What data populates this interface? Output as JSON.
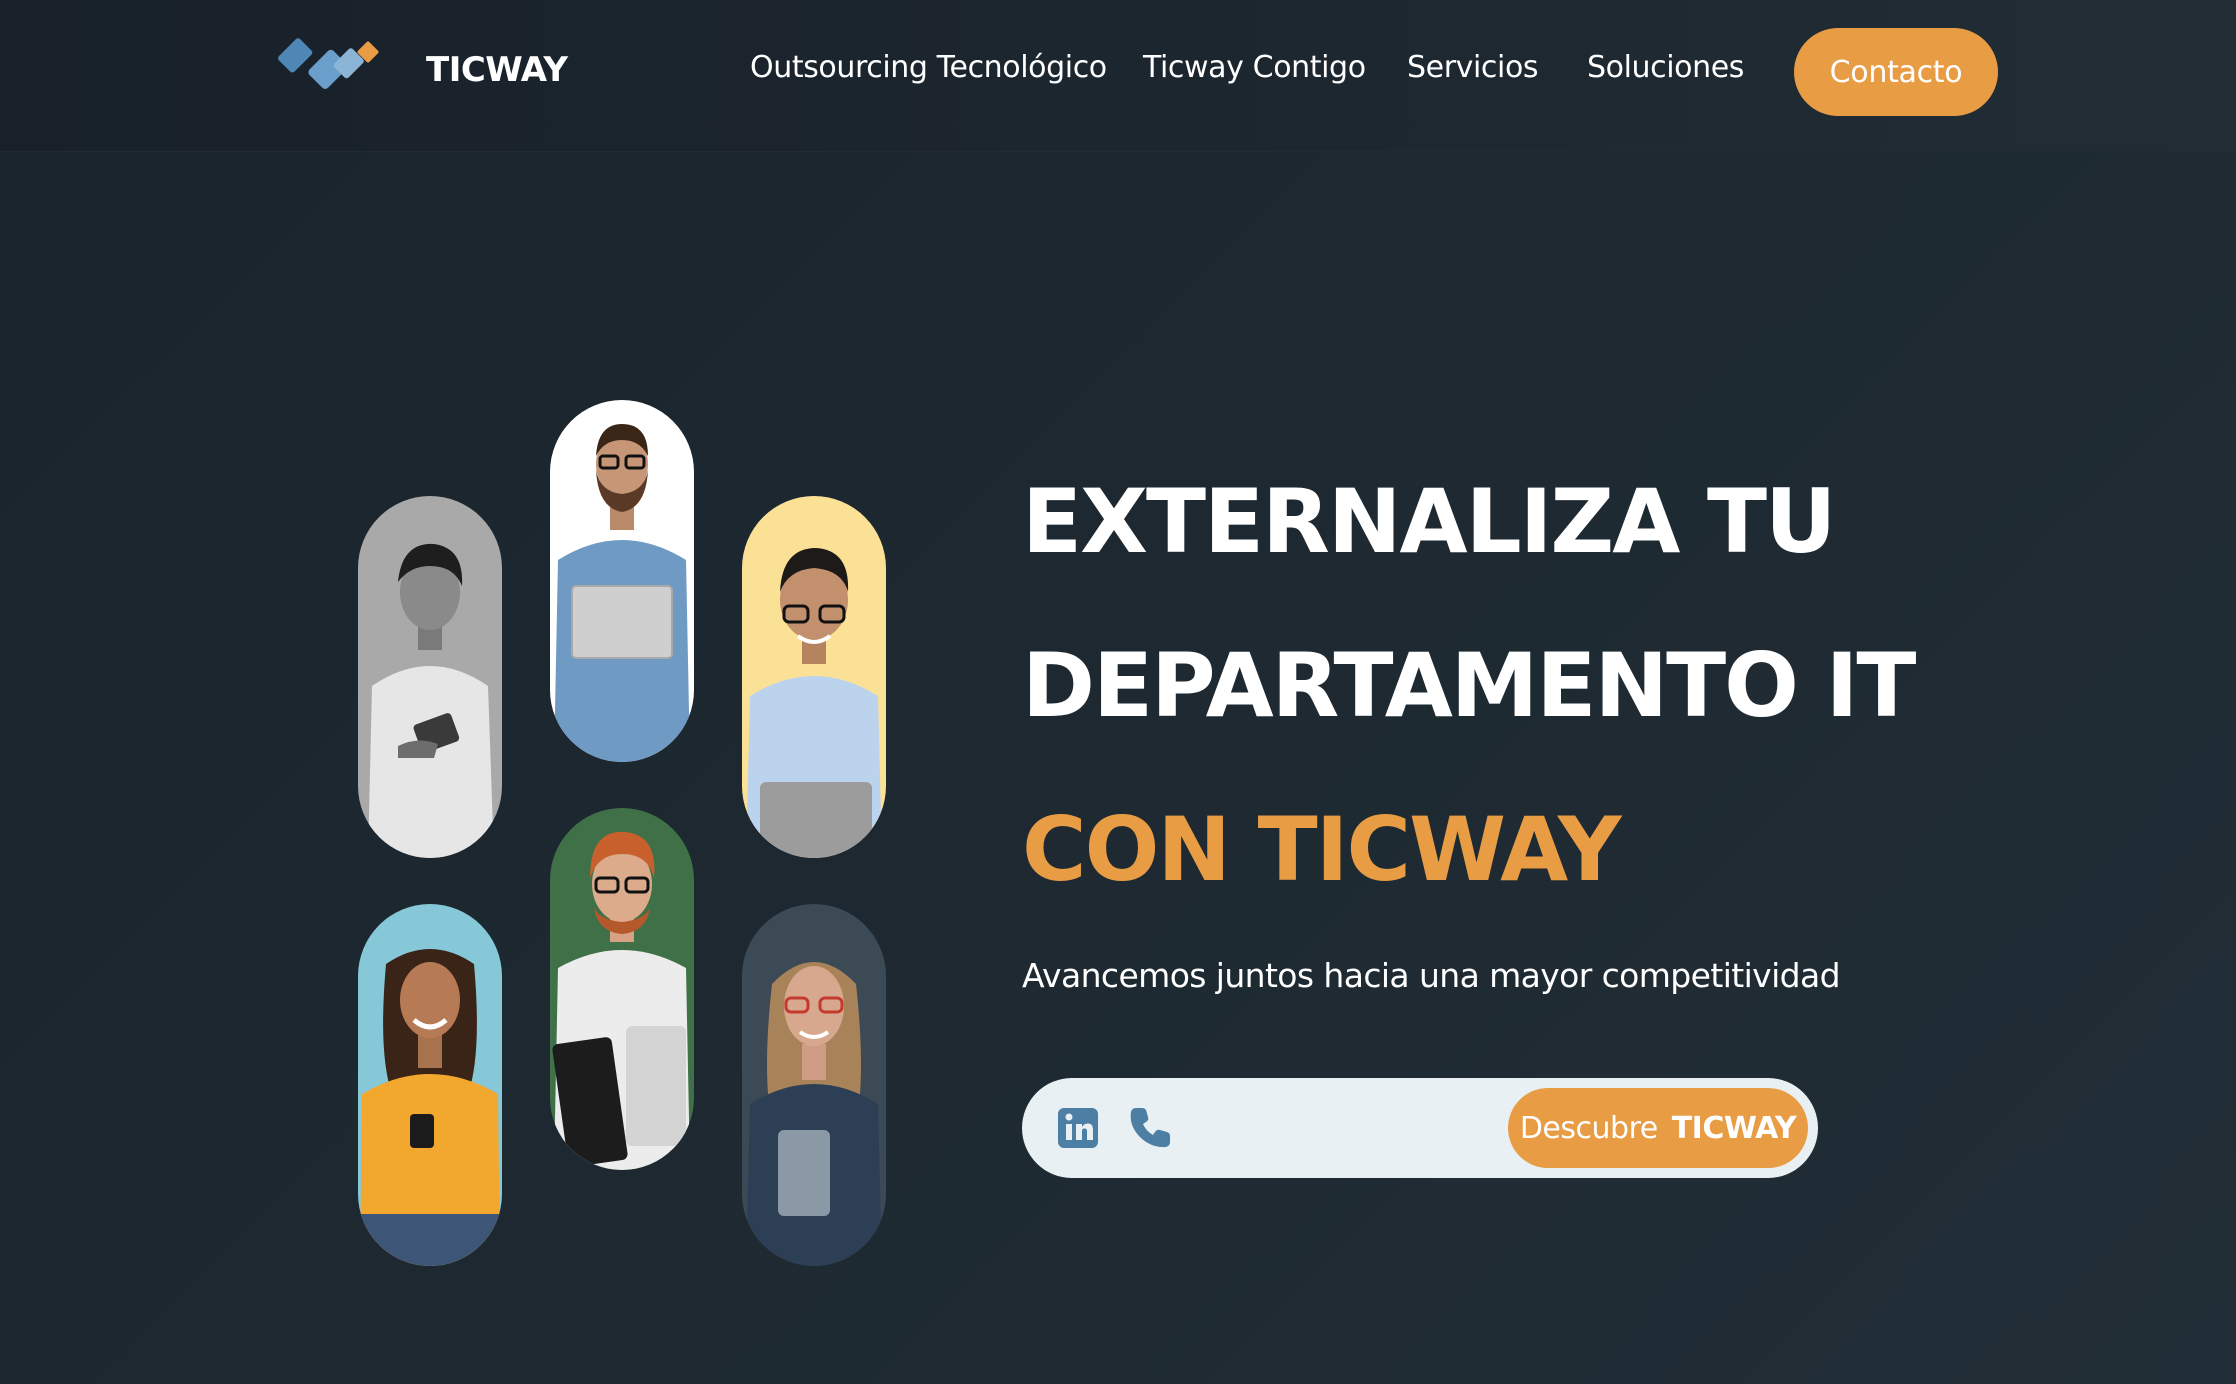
{
  "header": {
    "brand": "TICWAY",
    "nav": [
      {
        "label": "Outsourcing Tecnológico"
      },
      {
        "label": "Ticway Contigo"
      },
      {
        "label": "Servicios"
      },
      {
        "label": "Soluciones"
      }
    ],
    "cta_label": "Contacto"
  },
  "hero": {
    "line1": "EXTERNALIZA TU",
    "line2": "DEPARTAMENTO IT",
    "line3": "CON TICWAY",
    "subtitle": "Avancemos juntos hacia una mayor competitividad",
    "action_bar": {
      "icons": [
        "linkedin-icon",
        "phone-icon"
      ],
      "button_label": "Descubre",
      "button_label_strong": "TICWAY"
    }
  },
  "team_photos": [
    {
      "description_icon": "person-photo",
      "background": "#a9a9a9"
    },
    {
      "description_icon": "person-photo",
      "background": "#ffffff"
    },
    {
      "description_icon": "person-photo",
      "background": "#fbe196"
    },
    {
      "description_icon": "person-photo",
      "background": "#86c8d8"
    },
    {
      "description_icon": "person-photo",
      "background": "#3f7047"
    },
    {
      "description_icon": "person-photo",
      "background": "#3b4a55"
    }
  ],
  "colors": {
    "accent": "#e89c44",
    "background": "#1d2830",
    "text": "#ffffff",
    "action_bar_bg": "#e8f0f3",
    "icon": "#4d7ea3"
  }
}
